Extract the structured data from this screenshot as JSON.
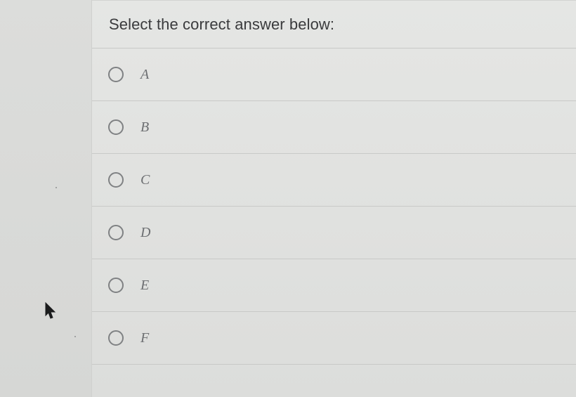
{
  "question": {
    "prompt": "Select the correct answer below:"
  },
  "options": [
    {
      "label": "A"
    },
    {
      "label": "B"
    },
    {
      "label": "C"
    },
    {
      "label": "D"
    },
    {
      "label": "E"
    },
    {
      "label": "F"
    }
  ],
  "icons": {
    "radio": "radio-unselected-icon",
    "cursor": "mouse-pointer-icon"
  },
  "colors": {
    "background": "#e2e3e1",
    "text": "#3a3b3d",
    "radio_border": "#7f8183",
    "divider": "#c8c9c7"
  }
}
